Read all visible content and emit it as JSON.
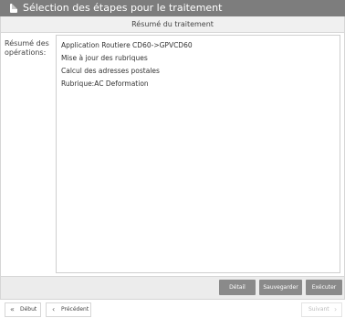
{
  "window": {
    "title": "Sélection des étapes pour le traitement",
    "icon": "document-icon"
  },
  "panel": {
    "header": "Résumé du traitement"
  },
  "summary": {
    "label": "Résumé des opérations:",
    "items": [
      "Application Routiere CD60->GPVCD60",
      "Mise à jour des rubriques",
      "Calcul des adresses postales",
      "Rubrique:AC Deformation"
    ]
  },
  "actions": {
    "detail": "Détail",
    "save": "Sauvegarder",
    "execute": "Exécuter"
  },
  "navigation": {
    "start": {
      "label": "Début",
      "icon": "double-chevron-left-icon"
    },
    "previous": {
      "label": "Précédent",
      "icon": "chevron-left-icon"
    },
    "next": {
      "label": "Suivant",
      "icon": "chevron-right-icon",
      "enabled": false
    }
  }
}
